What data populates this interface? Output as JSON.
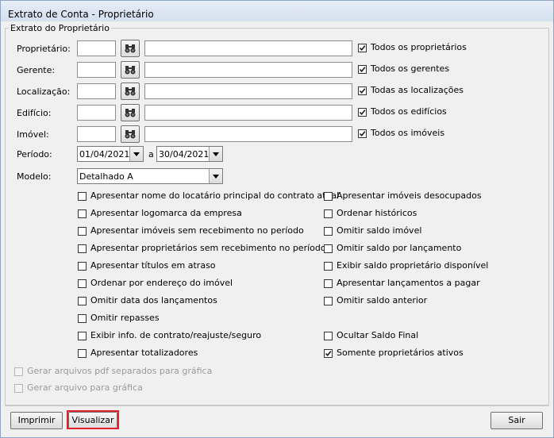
{
  "window": {
    "title": "Extrato de Conta - Proprietário"
  },
  "group": {
    "title": "Extrato do Proprietário"
  },
  "filters": [
    {
      "label": "Proprietário:",
      "code": "",
      "name": "",
      "all_label": "Todos os proprietários",
      "all_checked": true
    },
    {
      "label": "Gerente:",
      "code": "",
      "name": "",
      "all_label": "Todos os gerentes",
      "all_checked": true
    },
    {
      "label": "Localização:",
      "code": "",
      "name": "",
      "all_label": "Todas as localizações",
      "all_checked": true
    },
    {
      "label": "Edifício:",
      "code": "",
      "name": "",
      "all_label": "Todos os edifícios",
      "all_checked": true
    },
    {
      "label": "Imóvel:",
      "code": "",
      "name": "",
      "all_label": "Todos os imóveis",
      "all_checked": true
    }
  ],
  "period": {
    "label": "Período:",
    "start": "01/04/2021",
    "separator": "a",
    "end": "30/04/2021"
  },
  "model": {
    "label": "Modelo:",
    "value": "Detalhado A"
  },
  "options_left": [
    {
      "label": "Apresentar nome do locatário principal do contrato atual",
      "checked": false
    },
    {
      "label": "Apresentar logomarca da empresa",
      "checked": false
    },
    {
      "label": "Apresentar imóveis sem recebimento no período",
      "checked": false
    },
    {
      "label": "Apresentar proprietários sem recebimento no período",
      "checked": false
    },
    {
      "label": "Apresentar títulos em atraso",
      "checked": false
    },
    {
      "label": "Ordenar por endereço do imóvel",
      "checked": false
    },
    {
      "label": "Omitir data dos lançamentos",
      "checked": false
    },
    {
      "label": "Omitir repasses",
      "checked": false
    },
    {
      "label": "Exibir info. de contrato/reajuste/seguro",
      "checked": false
    },
    {
      "label": "Apresentar totalizadores",
      "checked": false
    }
  ],
  "options_right": [
    {
      "label": "Apresentar imóveis desocupados",
      "checked": false
    },
    {
      "label": "Ordenar históricos",
      "checked": false
    },
    {
      "label": "Omitir saldo imóvel",
      "checked": false
    },
    {
      "label": "Omitir saldo por lançamento",
      "checked": false
    },
    {
      "label": "Exibir saldo proprietário disponível",
      "checked": false
    },
    {
      "label": "Apresentar lançamentos a pagar",
      "checked": false
    },
    {
      "label": "Omitir saldo anterior",
      "checked": false
    },
    null,
    {
      "label": "Ocultar Saldo Final",
      "checked": false
    },
    {
      "label": "Somente proprietários ativos",
      "checked": true
    }
  ],
  "disabled_options": [
    {
      "label": "Gerar arquivos pdf separados para gráfica",
      "checked": false
    },
    {
      "label": "Gerar arquivo para gráfica",
      "checked": false
    }
  ],
  "buttons": {
    "print": "Imprimir",
    "view": "Visualizar",
    "exit": "Sair"
  },
  "colors": {
    "highlight": "#e0202a",
    "checkmark": "#1a1a1a"
  },
  "icons": {
    "lookup": "binoculars-icon",
    "dropdown": "chevron-down-icon"
  }
}
